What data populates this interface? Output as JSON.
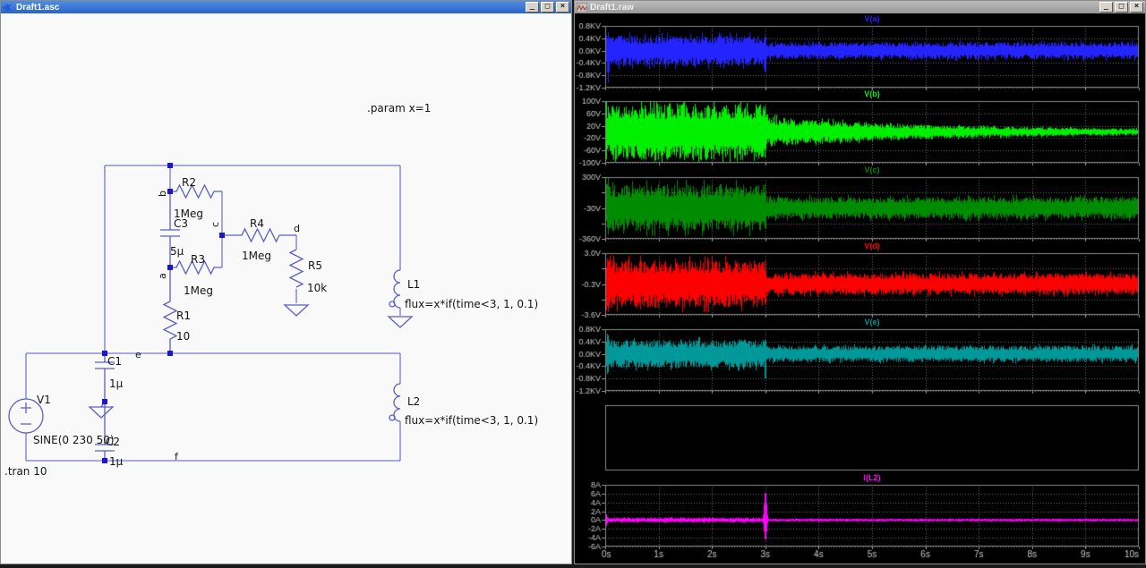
{
  "left_window": {
    "title": "Draft1.asc",
    "schematic": {
      "directive_param": ".param x=1",
      "directive_tran": ".tran 10",
      "r1": {
        "ref": "R1",
        "value": "10"
      },
      "r2": {
        "ref": "R2",
        "value": "1Meg"
      },
      "r3": {
        "ref": "R3",
        "value": "1Meg"
      },
      "r4": {
        "ref": "R4",
        "value": "1Meg"
      },
      "r5": {
        "ref": "R5",
        "value": "10k"
      },
      "c1": {
        "ref": "C1",
        "value": "1µ"
      },
      "c2": {
        "ref": "C2",
        "value": "1µ"
      },
      "c3": {
        "ref": "C3",
        "value": "5µ"
      },
      "v1": {
        "ref": "V1",
        "value": "SINE(0 230 50)"
      },
      "l1": {
        "ref": "L1",
        "value": "flux=x*if(time<3, 1, 0.1)"
      },
      "l2": {
        "ref": "L2",
        "value": "flux=x*if(time<3, 1, 0.1)"
      },
      "nets": {
        "a": "a",
        "b": "b",
        "c": "c",
        "d": "d",
        "e": "e",
        "f": "f"
      }
    }
  },
  "right_window": {
    "title": "Draft1.raw"
  },
  "window_controls": {
    "minimize": "_",
    "maximize": "□",
    "close": "×"
  },
  "xaxis": {
    "range_s": [
      0,
      10
    ],
    "tick_labels": [
      "0s",
      "1s",
      "2s",
      "3s",
      "4s",
      "5s",
      "6s",
      "7s",
      "8s",
      "9s",
      "10s"
    ]
  },
  "chart_data": [
    {
      "type": "line",
      "title": "V(a)",
      "color": "#2424ff",
      "unit": "KV",
      "ylim": [
        -1.2,
        0.8
      ],
      "yticks": [
        {
          "v": 0.8,
          "l": "0.8KV"
        },
        {
          "v": 0.4,
          "l": "0.4KV"
        },
        {
          "v": 0.0,
          "l": "0.0KV"
        },
        {
          "v": -0.4,
          "l": "-0.4KV"
        },
        {
          "v": -0.8,
          "l": "-0.8KV"
        },
        {
          "v": -1.2,
          "l": "-1.2KV"
        }
      ],
      "env": {
        "mid": 0,
        "amp_pre3": 0.5,
        "amp_post3": 0.28,
        "events": [
          {
            "t": 0.05,
            "min": -1.05,
            "max": 0.6,
            "w": 0.1
          },
          {
            "t": 3.0,
            "min": -0.95,
            "max": 0.65,
            "w": 0.06
          }
        ]
      }
    },
    {
      "type": "line",
      "title": "V(b)",
      "color": "#00f000",
      "unit": "V",
      "ylim": [
        -100,
        100
      ],
      "yticks": [
        {
          "v": 100,
          "l": "100V"
        },
        {
          "v": 60,
          "l": "60V"
        },
        {
          "v": 20,
          "l": "20V"
        },
        {
          "v": -20,
          "l": "-20V"
        },
        {
          "v": -60,
          "l": "-60V"
        },
        {
          "v": -100,
          "l": "-100V"
        }
      ],
      "env": {
        "mid": 0,
        "amp_pre3": 93,
        "post3_decay": {
          "a0": 44,
          "tau": 3.2,
          "a1": 6
        },
        "events": []
      }
    },
    {
      "type": "line",
      "title": "V(c)",
      "color": "#008c00",
      "unit": "V",
      "ylim": [
        -360,
        300
      ],
      "yticks": [
        {
          "v": 300,
          "l": "300V"
        },
        {
          "v": 135,
          "l": ""
        },
        {
          "v": -30,
          "l": "-30V"
        },
        {
          "v": -195,
          "l": ""
        },
        {
          "v": -360,
          "l": "-360V"
        }
      ],
      "env": {
        "mid": -30,
        "amp_pre3": 255,
        "amp_post3": 120,
        "events": [
          {
            "t": 0.05,
            "min": -320,
            "max": 295,
            "w": 0.08
          },
          {
            "t": 3.0,
            "min": -350,
            "max": 180,
            "w": 0.05
          }
        ]
      }
    },
    {
      "type": "line",
      "title": "V(d)",
      "color": "#ff0000",
      "unit": "V",
      "ylim": [
        -3.6,
        3.0
      ],
      "yticks": [
        {
          "v": 3.0,
          "l": "3.0V"
        },
        {
          "v": 1.35,
          "l": ""
        },
        {
          "v": -0.3,
          "l": "-0.3V"
        },
        {
          "v": -1.95,
          "l": ""
        },
        {
          "v": -3.6,
          "l": "-3.6V"
        }
      ],
      "env": {
        "mid": -0.3,
        "amp_pre3": 2.55,
        "amp_post3": 1.15,
        "events": [
          {
            "t": 0.04,
            "min": -3.1,
            "max": 2.9,
            "w": 0.08
          },
          {
            "t": 3.0,
            "min": -3.5,
            "max": 1.8,
            "w": 0.05
          }
        ]
      }
    },
    {
      "type": "line",
      "title": "V(e)",
      "color": "#009898",
      "unit": "KV",
      "ylim": [
        -1.2,
        0.8
      ],
      "yticks": [
        {
          "v": 0.8,
          "l": "0.8KV"
        },
        {
          "v": 0.4,
          "l": "0.4KV"
        },
        {
          "v": 0.0,
          "l": "0.0KV"
        },
        {
          "v": -0.4,
          "l": "-0.4KV"
        },
        {
          "v": -0.8,
          "l": "-0.8KV"
        },
        {
          "v": -1.2,
          "l": "-1.2KV"
        }
      ],
      "env": {
        "mid": 0,
        "amp_pre3": 0.46,
        "amp_post3": 0.27,
        "events": [
          {
            "t": 0.04,
            "min": -0.75,
            "max": 0.75,
            "w": 0.1
          },
          {
            "t": 3.0,
            "min": -1.1,
            "max": 0.55,
            "w": 0.06
          }
        ]
      }
    },
    {
      "type": "empty",
      "title": "",
      "color": "#000000",
      "ylim": [
        0,
        1
      ],
      "yticks": [],
      "env": {
        "mid": 0,
        "amp_pre3": 0,
        "amp_post3": 0,
        "events": []
      }
    },
    {
      "type": "line",
      "title": "I(L2)",
      "color": "#ff00ff",
      "unit": "A",
      "ylim": [
        -6,
        8
      ],
      "yticks": [
        {
          "v": 8,
          "l": "8A"
        },
        {
          "v": 6,
          "l": "6A"
        },
        {
          "v": 4,
          "l": "4A"
        },
        {
          "v": 2,
          "l": "2A"
        },
        {
          "v": 0,
          "l": "0A"
        },
        {
          "v": -2,
          "l": "-2A"
        },
        {
          "v": -4,
          "l": "-4A"
        },
        {
          "v": -6,
          "l": "-6A"
        }
      ],
      "env": {
        "mid": 0,
        "amp_pre3": 0.55,
        "amp_post3": 0.32,
        "events": [
          {
            "t": 0.02,
            "min": -1.5,
            "max": 1.5,
            "w": 0.06
          },
          {
            "t": 3.0,
            "min": -5.2,
            "max": 7.3,
            "w": 0.1
          }
        ]
      }
    }
  ]
}
